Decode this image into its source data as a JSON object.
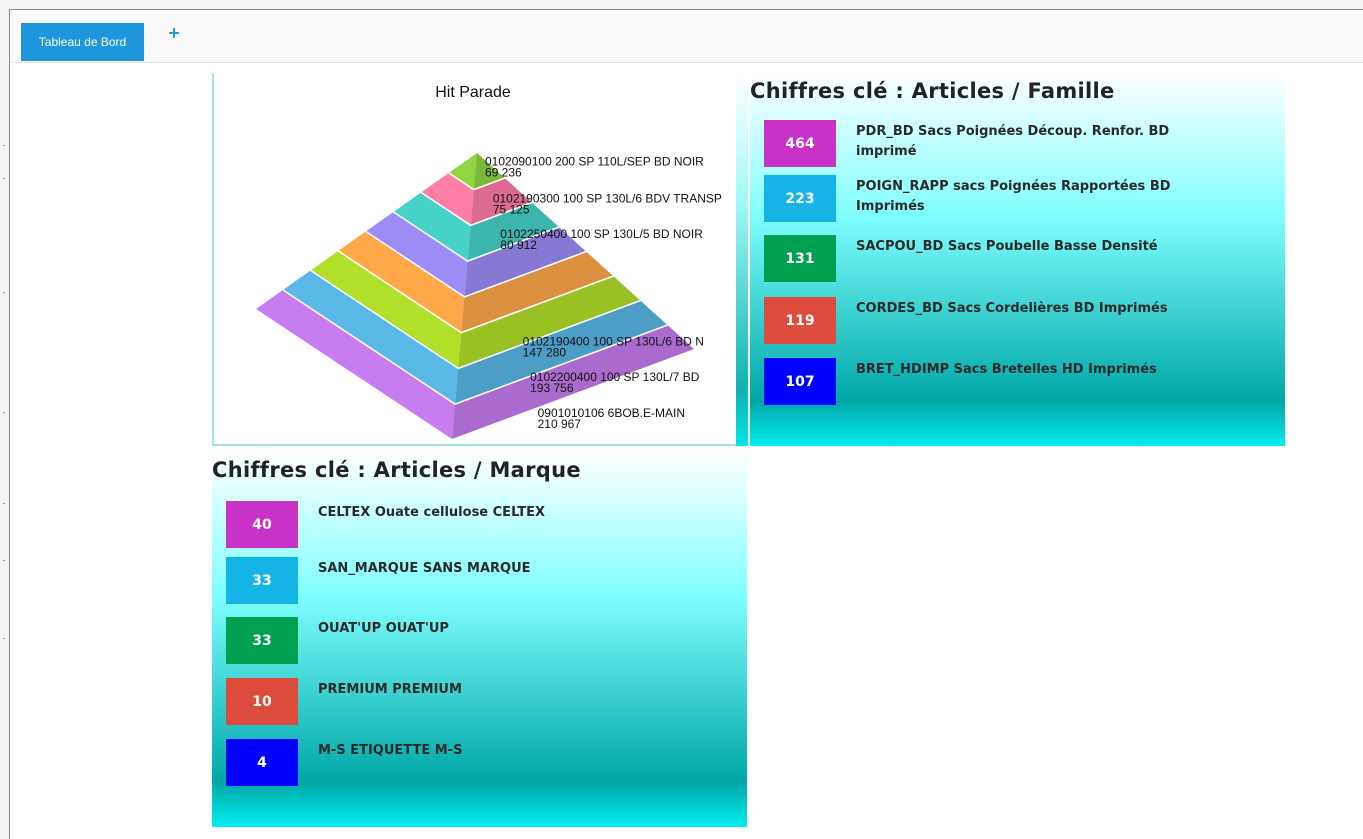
{
  "tabs": [
    {
      "label": "Tableau de Bord"
    }
  ],
  "add_tab_label": "+",
  "hit_parade": {
    "title": "Hit Parade",
    "levels": [
      {
        "code": "0102090100 200 SP 110L/SEP BD NOIR",
        "value": "69 236",
        "color": "#8fd640"
      },
      {
        "code": "0102190300 100 SP 130L/6 BDV TRANSP",
        "value": "75 125",
        "color": "#ff7ea8"
      },
      {
        "code": "0102250400 100 SP 130L/5 BD NOIR",
        "value": "80 912",
        "color": "#46d2c8"
      },
      {
        "code": "",
        "value": "",
        "color": "#9d8cf5"
      },
      {
        "code": "",
        "value": "",
        "color": "#ffa84a"
      },
      {
        "code": "0102190400 100 SP 130L/6 BD N",
        "value": "147 280",
        "color": "#b2e02a"
      },
      {
        "code": "0102200400 100 SP 130L/7 BD",
        "value": "193 756",
        "color": "#5ab8e6"
      },
      {
        "code": "0901010106 6BOB.E-MAIN",
        "value": "210 967",
        "color": "#c77cf0"
      }
    ],
    "extra_colors": [
      "#3aa0e8",
      "#d5e030"
    ]
  },
  "famille": {
    "title": "Chiffres clé : Articles / Famille",
    "items": [
      {
        "value": "464",
        "label": "PDR_BD Sacs Poignées Découp. Renfor. BD imprimé",
        "color": "#c832c8"
      },
      {
        "value": "223",
        "label": "POIGN_RAPP sacs Poignées Rapportées BD Imprimés",
        "color": "#14b4e6"
      },
      {
        "value": "131",
        "label": "SACPOU_BD Sacs Poubelle Basse Densité",
        "color": "#00a050"
      },
      {
        "value": "119",
        "label": "CORDES_BD Sacs Cordelières BD Imprimés",
        "color": "#dc4b3c"
      },
      {
        "value": "107",
        "label": "BRET_HDIMP Sacs Bretelles HD Imprimés",
        "color": "#0000ff"
      }
    ]
  },
  "marque": {
    "title": "Chiffres clé : Articles / Marque",
    "items": [
      {
        "value": "40",
        "label": "CELTEX Ouate cellulose CELTEX",
        "color": "#c832c8"
      },
      {
        "value": "33",
        "label": "SAN_MARQUE SANS MARQUE",
        "color": "#14b4e6"
      },
      {
        "value": "33",
        "label": "OUAT'UP OUAT'UP",
        "color": "#00a050"
      },
      {
        "value": "10",
        "label": "PREMIUM PREMIUM",
        "color": "#dc4b3c"
      },
      {
        "value": "4",
        "label": "M-S ETIQUETTE M-S",
        "color": "#0000ff"
      }
    ]
  }
}
